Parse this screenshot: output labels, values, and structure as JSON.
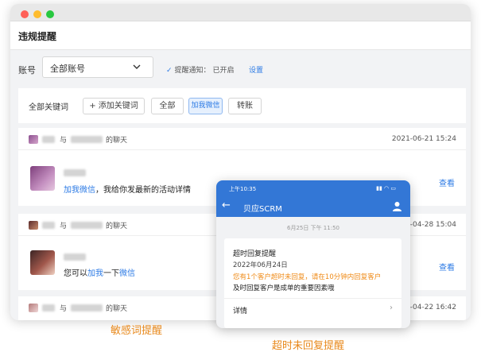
{
  "window": {
    "title": "违规提醒"
  },
  "filter": {
    "account_label": "账号",
    "account_value": "全部账号",
    "notify_label": "提醒通知：",
    "notify_status": "已开启",
    "settings_link": "设置"
  },
  "keywords": {
    "label": "全部关键词",
    "add_button": "+ 添加关键词",
    "tags": [
      "全部",
      "加我微信",
      "转账"
    ],
    "active_tag": "加我微信"
  },
  "chats": [
    {
      "connector": "与",
      "suffix": "的聊天",
      "date": "2021-06-21 15:24",
      "message_highlight": "加我微信",
      "message_rest": "，我给你发最新的活动详情",
      "action": "查看"
    },
    {
      "connector": "与",
      "suffix": "的聊天",
      "date": "-04-28 15:04",
      "message_prefix": "您可以",
      "message_hl1": "加我",
      "message_mid": "一下",
      "message_hl2": "微信",
      "action": "查看"
    },
    {
      "connector": "与",
      "suffix": "的聊天",
      "date": "-04-22 16:42"
    }
  ],
  "captions": {
    "left": "敏感词提醒",
    "right": "超时未回复提醒"
  },
  "phone": {
    "status_time": "上午10:35",
    "app_title": "贝应SCRM",
    "timestamp": "6月25日  下午 11:50",
    "notice": {
      "title": "超时回复提醒",
      "date": "2022年06月24日",
      "warning": "您有1个客户超时未回复，请在10分钟内回复客户",
      "body": "及时回复客户是成单的重要因素哦",
      "detail": "详情"
    }
  },
  "colors": {
    "accent": "#2d7be5",
    "phone_bar": "#3377d6",
    "caption": "#e8891c",
    "warning": "#ef8a16"
  }
}
